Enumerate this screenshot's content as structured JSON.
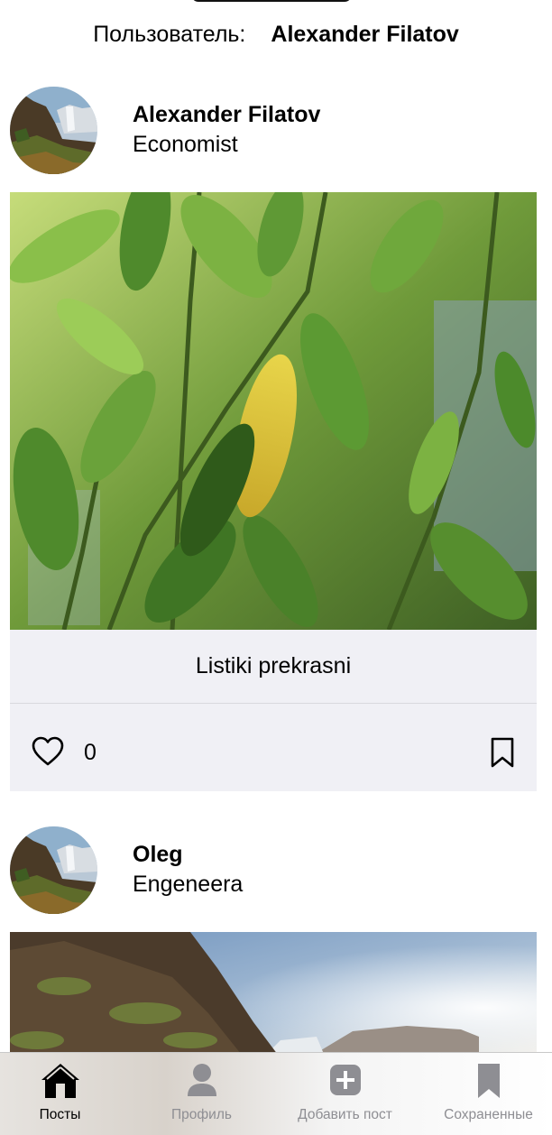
{
  "header": {
    "user_label": "Пользователь:",
    "user_name": "Alexander Filatov"
  },
  "posts": [
    {
      "author_name": "Alexander Filatov",
      "author_role": "Economist",
      "caption": "Listiki prekrasni",
      "likes": "0"
    },
    {
      "author_name": "Oleg",
      "author_role": "Engeneera"
    }
  ],
  "tabs": [
    {
      "label": "Посты",
      "icon": "house-icon",
      "active": true
    },
    {
      "label": "Профиль",
      "icon": "person-icon",
      "active": false
    },
    {
      "label": "Добавить пост",
      "icon": "plus-square-icon",
      "active": false
    },
    {
      "label": "Сохраненные",
      "icon": "bookmark-icon",
      "active": false
    }
  ],
  "colors": {
    "caption_bg": "#f0f0f5",
    "inactive_tab": "#8e8e93",
    "active_tab": "#000000"
  }
}
